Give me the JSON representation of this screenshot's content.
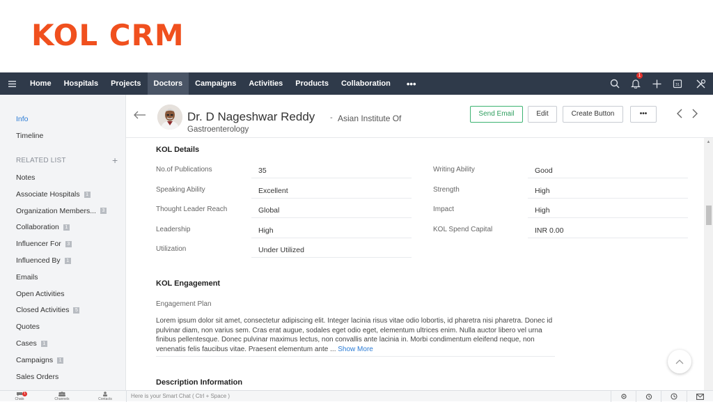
{
  "brand": {
    "title": "KOL CRM"
  },
  "nav": {
    "items": [
      "Home",
      "Hospitals",
      "Projects",
      "Doctors",
      "Campaigns",
      "Activities",
      "Products",
      "Collaboration"
    ],
    "active": "Doctors",
    "more": "•••",
    "notification_count": "1"
  },
  "sidebar": {
    "info": "Info",
    "timeline": "Timeline",
    "related_heading": "RELATED LIST",
    "items": [
      {
        "label": "Notes",
        "count": ""
      },
      {
        "label": "Associate Hospitals",
        "count": "1"
      },
      {
        "label": "Organization Members...",
        "count": "3"
      },
      {
        "label": "Collaboration",
        "count": "1"
      },
      {
        "label": "Influencer For",
        "count": "3"
      },
      {
        "label": "Influenced By",
        "count": "1"
      },
      {
        "label": "Emails",
        "count": ""
      },
      {
        "label": "Open Activities",
        "count": ""
      },
      {
        "label": "Closed Activities",
        "count": "5"
      },
      {
        "label": "Quotes",
        "count": ""
      },
      {
        "label": "Cases",
        "count": "1"
      },
      {
        "label": "Campaigns",
        "count": "1"
      },
      {
        "label": "Sales Orders",
        "count": ""
      }
    ]
  },
  "record": {
    "name": "Dr. D Nageshwar Reddy",
    "separator": "-",
    "institute_line1": "Asian Institute Of",
    "institute_line2": "Gastroenterology",
    "buttons": {
      "send_email": "Send Email",
      "edit": "Edit",
      "create": "Create Button",
      "more": "•••"
    }
  },
  "kol_details": {
    "title": "KOL Details",
    "left": [
      {
        "label": "No.of Publications",
        "value": "35"
      },
      {
        "label": "Speaking Ability",
        "value": "Excellent"
      },
      {
        "label": "Thought Leader Reach",
        "value": "Global"
      },
      {
        "label": "Leadership",
        "value": "High"
      },
      {
        "label": "Utilization",
        "value": "Under Utilized"
      }
    ],
    "right": [
      {
        "label": "Writing Ability",
        "value": "Good"
      },
      {
        "label": "Strength",
        "value": "High"
      },
      {
        "label": "Impact",
        "value": "High"
      },
      {
        "label": "KOL Spend Capital",
        "value": "INR 0.00"
      }
    ]
  },
  "kol_engagement": {
    "title": "KOL Engagement",
    "plan_label": "Engagement Plan",
    "plan_text": "Lorem ipsum dolor sit amet, consectetur adipiscing elit. Integer lacinia risus vitae odio lobortis, id pharetra nisi pharetra. Donec id pulvinar diam, non varius sem. Cras erat augue, sodales eget odio eget, elementum ultrices enim. Nulla auctor libero vel urna finibus pellentesque. Donec pulvinar maximus lectus, non convallis ante lacinia in. Morbi condimentum eleifend neque, non venenatis felis faucibus vitae. Praesent elementum ante ...",
    "show_more": "Show More"
  },
  "description": {
    "title": "Description Information"
  },
  "bottombar": {
    "chats": "Chats",
    "channels": "Channels",
    "contacts": "Contacts",
    "chat_badge": "1",
    "chat_placeholder": "Here is your Smart Chat ( Ctrl + Space )"
  },
  "colors": {
    "brand": "#f0501e",
    "nav_bg": "#2f3a4a",
    "link": "#2a7bd5",
    "green": "#3cb371"
  }
}
